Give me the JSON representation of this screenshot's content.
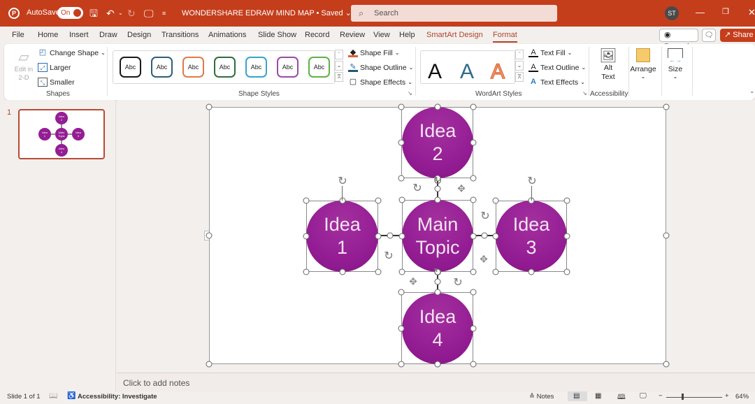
{
  "titlebar": {
    "autosave_label": "AutoSave",
    "autosave_state": "On",
    "doc_title": "WONDERSHARE EDRAW MIND MAP • Saved",
    "search_placeholder": "Search",
    "user_initials": "ST",
    "icons": [
      "powerpoint-logo-icon",
      "save-icon",
      "undo-icon",
      "redo-icon",
      "present-icon",
      "customize-qat-icon"
    ]
  },
  "menu": {
    "items": [
      "File",
      "Home",
      "Insert",
      "Draw",
      "Design",
      "Transitions",
      "Animations",
      "Slide Show",
      "Record",
      "Review",
      "View",
      "Help",
      "SmartArt Design",
      "Format"
    ],
    "active": "Format",
    "record_label": "Record",
    "share_label": "Share"
  },
  "ribbon": {
    "shapes": {
      "edit2d_label": "Edit in 2-D",
      "change_shape": "Change Shape",
      "larger": "Larger",
      "smaller": "Smaller",
      "group_label": "Shapes"
    },
    "shape_styles": {
      "swatch_text": "Abc",
      "swatch_colors": [
        "#1a1a1a",
        "#2e5f7a",
        "#e07a4a",
        "#2f6e3c",
        "#3aa3c9",
        "#9b4aa8",
        "#5fb04a"
      ],
      "shape_fill": "Shape Fill",
      "shape_outline": "Shape Outline",
      "shape_effects": "Shape Effects",
      "group_label": "Shape Styles"
    },
    "wordart": {
      "glyph": "A",
      "text_fill": "Text Fill",
      "text_outline": "Text Outline",
      "text_effects": "Text Effects",
      "group_label": "WordArt Styles"
    },
    "accessibility": {
      "alt_text_1": "Alt",
      "alt_text_2": "Text",
      "group_label": "Accessibility"
    },
    "arrange_label": "Arrange",
    "size_label": "Size"
  },
  "slides_panel": {
    "slide_number": "1"
  },
  "slide": {
    "nodes": [
      {
        "id": "main",
        "line1": "Main",
        "line2": "Topic"
      },
      {
        "id": "idea1",
        "line1": "Idea",
        "line2": "1"
      },
      {
        "id": "idea2",
        "line1": "Idea",
        "line2": "2"
      },
      {
        "id": "idea3",
        "line1": "Idea",
        "line2": "3"
      },
      {
        "id": "idea4",
        "line1": "Idea",
        "line2": "4"
      }
    ],
    "node_color": "#941d94"
  },
  "notes": {
    "placeholder": "Click to add notes"
  },
  "statusbar": {
    "slide_info": "Slide 1 of 1",
    "accessibility": "Accessibility: Investigate",
    "notes_label": "Notes",
    "zoom": "64%"
  }
}
